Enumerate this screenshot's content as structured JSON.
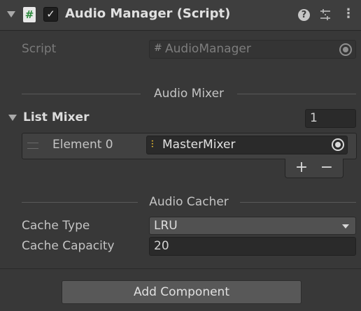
{
  "component": {
    "title": "Audio Manager (Script)",
    "enabled": true,
    "script_icon": "#",
    "check_glyph": "✓",
    "help_glyph": "?",
    "menu_glyph": "⋮"
  },
  "script_row": {
    "label": "Script",
    "value": "AudioManager",
    "value_icon": "#"
  },
  "sections": {
    "audio_mixer": "Audio Mixer",
    "audio_cacher": "Audio Cacher"
  },
  "list_mixer": {
    "label": "List Mixer",
    "size": "1",
    "elements": [
      {
        "label": "Element 0",
        "value": "MasterMixer"
      }
    ],
    "add_label": "+",
    "remove_label": "−"
  },
  "cache_type": {
    "label": "Cache Type",
    "value": "LRU"
  },
  "cache_capacity": {
    "label": "Cache Capacity",
    "value": "20"
  },
  "add_component": {
    "label": "Add Component"
  },
  "colors": {
    "background": "#383838",
    "header": "#3e3e3e",
    "field": "#2a2a2a",
    "button": "#585858",
    "mixer_icon": "#e0b630"
  }
}
